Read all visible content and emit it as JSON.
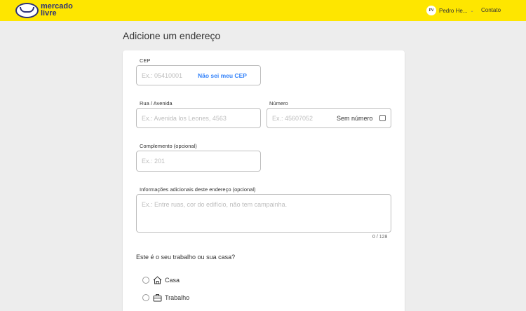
{
  "header": {
    "logo_text_line1": "mercado",
    "logo_text_line2": "livre",
    "user_initials": "PV",
    "user_name": "Pedro He...",
    "contact": "Contato",
    "brand_color": "#fee600"
  },
  "page": {
    "title": "Adicione um endereço"
  },
  "form": {
    "cep": {
      "label": "CEP",
      "placeholder": "Ex.: 05410001",
      "help_link": "Não sei meu CEP"
    },
    "street": {
      "label": "Rua / Avenida",
      "placeholder": "Ex.: Avenida los Leones, 4563"
    },
    "number": {
      "label": "Número",
      "placeholder": "Ex.: 45607052",
      "no_number_label": "Sem número"
    },
    "complement": {
      "label": "Complemento (opcional)",
      "placeholder": "Ex.: 201"
    },
    "additional_info": {
      "label": "Informações adicionais deste endereço (opcional)",
      "placeholder": "Ex.: Entre ruas, cor do edifício, não tem campainha.",
      "counter": "0 / 128"
    },
    "address_type": {
      "question": "Este é o seu trabalho ou sua casa?",
      "options": [
        {
          "label": "Casa",
          "icon": "home-icon"
        },
        {
          "label": "Trabalho",
          "icon": "briefcase-icon"
        }
      ]
    }
  },
  "colors": {
    "link": "#3483fa",
    "background": "#ededed"
  }
}
